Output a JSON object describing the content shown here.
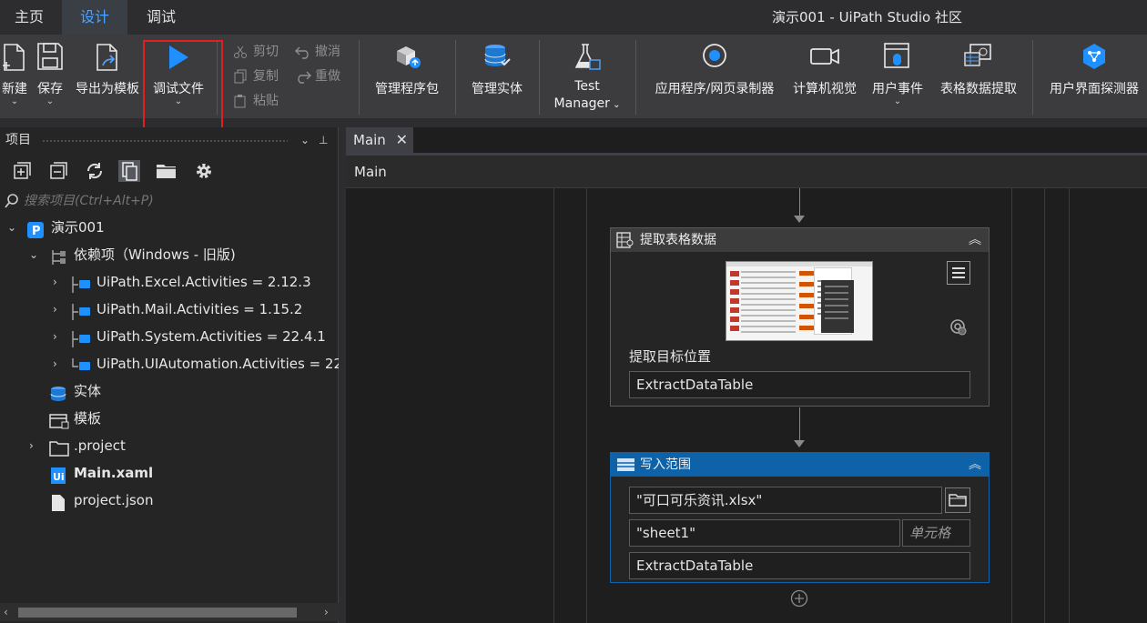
{
  "window": {
    "title": "演示001 - UiPath Studio 社区"
  },
  "menu_tabs": [
    {
      "label": "主页",
      "active": false
    },
    {
      "label": "设计",
      "active": true
    },
    {
      "label": "调试",
      "active": false
    }
  ],
  "ribbon": {
    "new": "新建",
    "save": "保存",
    "export_template": "导出为模板",
    "debug_file": "调试文件",
    "cut": "剪切",
    "copy": "复制",
    "paste": "粘贴",
    "undo": "撤消",
    "redo": "重做",
    "manage_packages": "管理程序包",
    "manage_entities": "管理实体",
    "test_manager_line1": "Test",
    "test_manager_line2": "Manager",
    "app_recorder": "应用程序/网页录制器",
    "computer_vision": "计算机视觉",
    "user_events": "用户事件",
    "table_extraction": "表格数据提取",
    "ui_explorer": "用户界面探测器",
    "accent_color": "#1e90ff"
  },
  "project_panel": {
    "title": "项目",
    "search_placeholder": "搜索项目(Ctrl+Alt+P)",
    "tree": {
      "root": "演示001",
      "dependencies": "依赖项（Windows - 旧版)",
      "deps": [
        "UiPath.Excel.Activities = 2.12.3",
        "UiPath.Mail.Activities = 1.15.2",
        "UiPath.System.Activities = 22.4.1",
        "UiPath.UIAutomation.Activities = 22."
      ],
      "entities": "实体",
      "templates": "模板",
      "project_folder": ".project",
      "main_xaml": "Main.xaml",
      "project_json": "project.json"
    }
  },
  "designer": {
    "tab": "Main",
    "breadcrumb": "Main",
    "activities": {
      "extract": {
        "title": "提取表格数据",
        "target_label": "提取目标位置",
        "target_value": "ExtractDataTable"
      },
      "write_range": {
        "title": "写入范围",
        "workbook": "\"可口可乐资讯.xlsx\"",
        "sheet": "\"sheet1\"",
        "cell_placeholder": "单元格",
        "datatable": "ExtractDataTable",
        "header_color": "#0e62a8"
      }
    }
  }
}
